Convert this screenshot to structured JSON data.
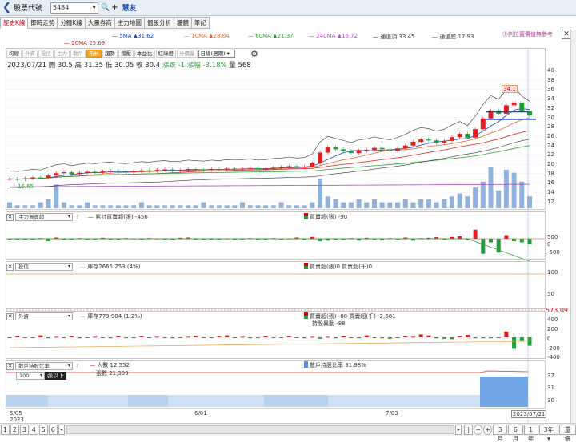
{
  "header": {
    "back_icon": "chevron-left-icon",
    "title": "股票代號",
    "code": "5484",
    "name": "慧友"
  },
  "tabs": [
    {
      "label": "歷史K線",
      "active": true
    },
    {
      "label": "即時走勢"
    },
    {
      "label": "分鐘K線"
    },
    {
      "label": "大量券商"
    },
    {
      "label": "主力地圖"
    },
    {
      "label": "個股分析"
    },
    {
      "label": "疆鏡"
    },
    {
      "label": "筆記"
    }
  ],
  "warning": "⓵判位置價值無參考",
  "ma_legend": [
    {
      "label": "5MA ▲31.62",
      "color": "#1f3fbf"
    },
    {
      "label": "10MA ▲28.64",
      "color": "#e66a2c"
    },
    {
      "label": "60MA ▲21.37",
      "color": "#2e9e3a"
    },
    {
      "label": "240MA ▲15.72",
      "color": "#b04ac8"
    },
    {
      "label": "通道頂 33.45",
      "color": "#333333"
    },
    {
      "label": "通道底 17.93",
      "color": "#333333"
    },
    {
      "label": "20MA 25.69",
      "color": "#e02020"
    }
  ],
  "subtabs": [
    "均線",
    "外資",
    "投信",
    "主力",
    "散戶",
    "布林",
    "趨勢",
    "撐壓",
    "本益比",
    "紅綠燈",
    "分價量"
  ],
  "period_select": "日線(週期)",
  "info": {
    "date": "2023/07/21",
    "open": "開 30.5",
    "high": "高 31.35",
    "low": "低 30.05",
    "close": "收 30.4",
    "change": "漲跌 -1",
    "pct": "漲幅 -3.18%",
    "volume": "量 568"
  },
  "price_axis": [
    "40",
    "38",
    "36",
    "34",
    "32",
    "30",
    "28",
    "26",
    "24",
    "22",
    "20",
    "18",
    "16",
    "14",
    "12"
  ],
  "labels": {
    "high_label": "34.1",
    "low_label": "16.65"
  },
  "panel1": {
    "select": "主力買賣超",
    "legend1": "累計買賣超(張) -456",
    "legend2": "買賣超(張) -90",
    "axis": [
      "500",
      "0",
      "-500"
    ]
  },
  "panel2": {
    "select": "投信",
    "legend1": "庫存2665.253 (4%)",
    "legend2": "買賣超(張)0 買賣超(千)0",
    "axis": [
      "100",
      "50"
    ]
  },
  "panel3": {
    "select": "外資",
    "legend1": "庫存779.904 (1.2%)",
    "legend2": "買賣超(張) -88 買賣超(千) -2,681",
    "legend3": "持股異動 -88",
    "axis": [
      "400",
      "200",
      "0",
      "-200",
      "-400"
    ],
    "price_tag": "573.09"
  },
  "panel4": {
    "select": "散戶持股比率",
    "subselect": "100",
    "sublabel": "張以下",
    "legend1": "人數 12,552",
    "legend2": "張數 21,399",
    "legend3": "散戶持股比率 31.98%",
    "axis": [
      "32",
      "31",
      "30"
    ]
  },
  "dates": {
    "d1": "5/05",
    "d1y": "2023",
    "d2": "6/01",
    "d3": "7/03",
    "dend": "2023/07/21"
  },
  "bottom": {
    "pages": [
      "1",
      "2",
      "3",
      "4",
      "5",
      "6"
    ],
    "ranges": [
      "3月",
      "6月",
      "1年",
      "3年",
      "還價"
    ]
  }
}
